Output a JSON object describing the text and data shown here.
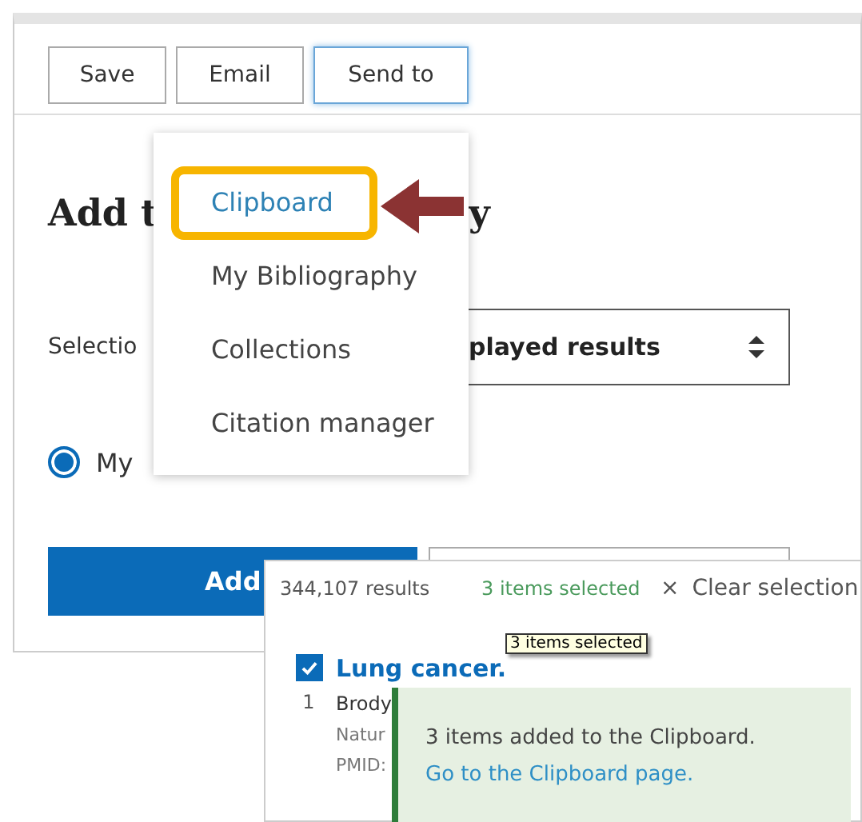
{
  "toolbar": {
    "buttons": [
      {
        "label": "Save",
        "focused": false
      },
      {
        "label": "Email",
        "focused": false
      },
      {
        "label": "Send to",
        "focused": true
      }
    ]
  },
  "dialog": {
    "heading_start": "Add t",
    "heading_end": "y",
    "selection_label": "Selectio",
    "select_value": "played results",
    "options": [
      {
        "label": "My",
        "selected": true
      }
    ],
    "add_button": "Add"
  },
  "send_menu": {
    "items": [
      {
        "label": "Clipboard",
        "highlighted": true
      },
      {
        "label": "My Bibliography",
        "highlighted": false
      },
      {
        "label": "Collections",
        "highlighted": false
      },
      {
        "label": "Citation manager",
        "highlighted": false
      }
    ]
  },
  "results": {
    "count": "344,107 results",
    "selected_count": "3 items selected",
    "clear_icon": "×",
    "clear": "Clear selection",
    "tooltip": "3 items selected",
    "items": [
      {
        "checked": true,
        "title": "Lung cancer.",
        "number": "1",
        "authors": "Brody",
        "journal": "Natur",
        "pmid": "PMID:"
      }
    ]
  },
  "toast": {
    "message": "3 items added to the Clipboard.",
    "link": "Go to the Clipboard page."
  }
}
